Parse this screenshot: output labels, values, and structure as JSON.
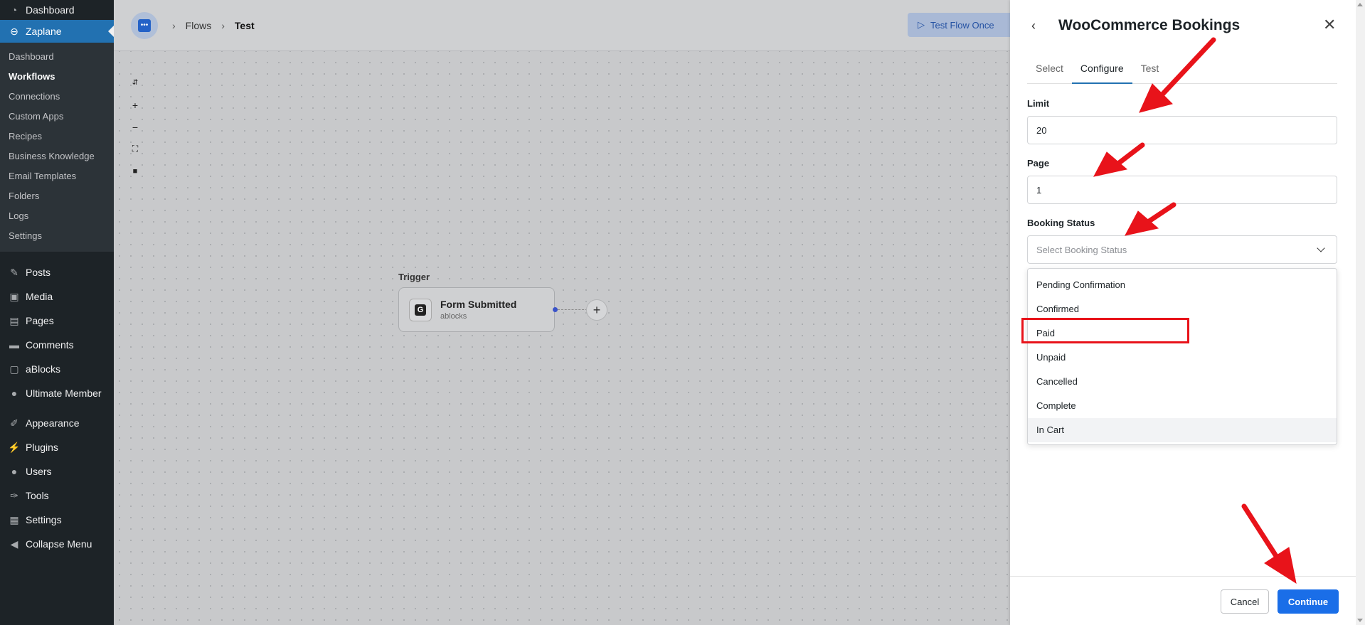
{
  "sidebar": {
    "top_items": [
      {
        "label": "Dashboard",
        "icon": "dashboard-icon"
      },
      {
        "label": "Zaplane",
        "icon": "zaplane-icon"
      }
    ],
    "sub_items": [
      "Dashboard",
      "Workflows",
      "Connections",
      "Custom Apps",
      "Recipes",
      "Business Knowledge",
      "Email Templates",
      "Folders",
      "Logs",
      "Settings"
    ],
    "current_sub": "Workflows",
    "items": [
      {
        "label": "Posts",
        "icon": "pin-icon"
      },
      {
        "label": "Media",
        "icon": "media-icon"
      },
      {
        "label": "Pages",
        "icon": "pages-icon"
      },
      {
        "label": "Comments",
        "icon": "comment-icon"
      },
      {
        "label": "aBlocks",
        "icon": "ablocks-icon"
      },
      {
        "label": "Ultimate Member",
        "icon": "user-icon"
      },
      {
        "label": "Appearance",
        "icon": "brush-icon"
      },
      {
        "label": "Plugins",
        "icon": "plug-icon"
      },
      {
        "label": "Users",
        "icon": "users-icon"
      },
      {
        "label": "Tools",
        "icon": "wrench-icon"
      },
      {
        "label": "Settings",
        "icon": "settings-icon"
      },
      {
        "label": "Collapse Menu",
        "icon": "collapse-icon"
      }
    ]
  },
  "breadcrumb": {
    "flows": "Flows",
    "current": "Test"
  },
  "topbar": {
    "test_button": "Test Flow Once"
  },
  "canvas": {
    "trigger_label": "Trigger",
    "node": {
      "title": "Form Submitted",
      "subtitle": "ablocks"
    }
  },
  "panel": {
    "title": "WooCommerce Bookings",
    "tabs": [
      "Select",
      "Configure",
      "Test"
    ],
    "active_tab": "Configure",
    "fields": {
      "limit": {
        "label": "Limit",
        "value": "20"
      },
      "page": {
        "label": "Page",
        "value": "1"
      },
      "booking_status": {
        "label": "Booking Status",
        "placeholder": "Select Booking Status"
      }
    },
    "options": [
      "Pending Confirmation",
      "Confirmed",
      "Paid",
      "Unpaid",
      "Cancelled",
      "Complete",
      "In Cart"
    ],
    "highlighted_option": "Paid",
    "hovered_option": "In Cart",
    "cancel_label": "Cancel",
    "continue_label": "Continue"
  },
  "colors": {
    "accent": "#2271b1",
    "primary_button": "#1a6ee8",
    "annotation": "#e8131a",
    "sidebar": "#1d2327"
  }
}
